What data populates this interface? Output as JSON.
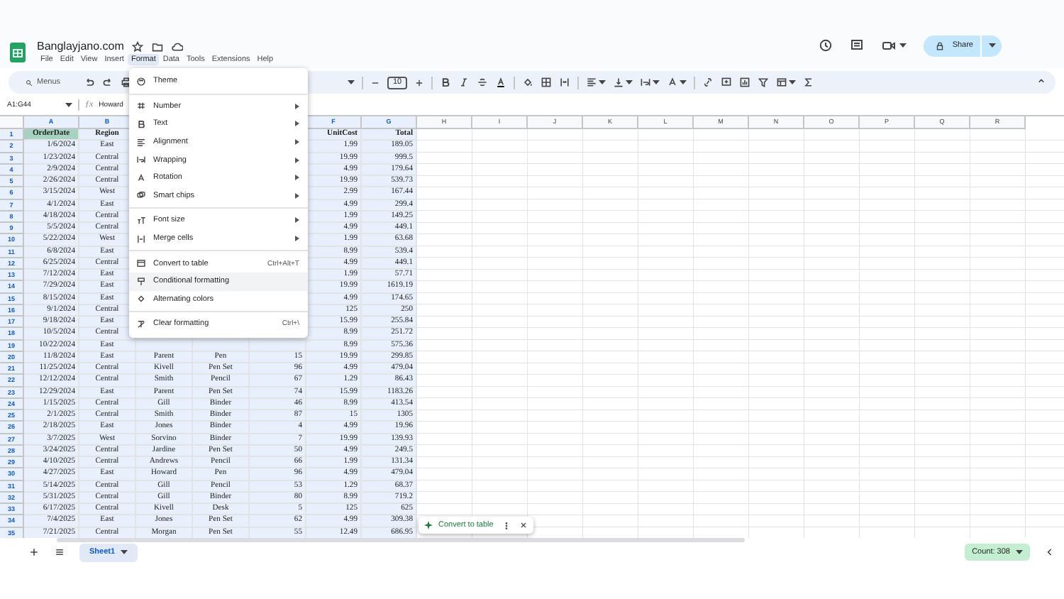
{
  "document": {
    "title": "Banglayjano.com",
    "menus": [
      {
        "label": "File",
        "selected": false
      },
      {
        "label": "Edit",
        "selected": false
      },
      {
        "label": "View",
        "selected": false
      },
      {
        "label": "Insert",
        "selected": false
      },
      {
        "label": "Format",
        "selected": true
      },
      {
        "label": "Data",
        "selected": false
      },
      {
        "label": "Tools",
        "selected": false
      },
      {
        "label": "Extensions",
        "selected": false
      },
      {
        "label": "Help",
        "selected": false
      }
    ],
    "share_button": "Share"
  },
  "toolbar": {
    "search": {
      "placeholder": "Menus"
    },
    "font_size": "10"
  },
  "formula_bar": {
    "name_box": "A1:G44",
    "function_symbol": "ƒx",
    "formula": "Howard"
  },
  "grid": {
    "columns": [
      {
        "label": "A",
        "selected": true
      },
      {
        "label": "B",
        "selected": true
      },
      null,
      null,
      null,
      {
        "label": "F",
        "selected": true
      },
      {
        "label": "G",
        "selected": true
      },
      {
        "label": "H",
        "selected": false
      },
      {
        "label": "I",
        "selected": false
      },
      {
        "label": "J",
        "selected": false
      },
      {
        "label": "K",
        "selected": false
      },
      {
        "label": "L",
        "selected": false
      },
      {
        "label": "M",
        "selected": false
      },
      {
        "label": "N",
        "selected": false
      },
      {
        "label": "O",
        "selected": false
      },
      {
        "label": "P",
        "selected": false
      },
      {
        "label": "Q",
        "selected": false
      },
      {
        "label": "R",
        "selected": false
      }
    ],
    "rows": [
      {
        "number": "1",
        "selected": true,
        "header": true,
        "cells": {
          "A": {
            "text": "OrderDate",
            "active": true
          },
          "B": "Region",
          "F": "UnitCost",
          "G": "Total"
        }
      },
      {
        "number": "2",
        "selected": true,
        "header": false,
        "cells": {
          "A": "1/6/2024",
          "B": "East",
          "F": "1.99",
          "G": "189.05"
        }
      },
      {
        "number": "3",
        "selected": true,
        "header": false,
        "cells": {
          "A": "1/23/2024",
          "B": "Central",
          "F": "19.99",
          "G": "999.5"
        }
      },
      {
        "number": "4",
        "selected": true,
        "header": false,
        "cells": {
          "A": "2/9/2024",
          "B": "Central",
          "F": "4.99",
          "G": "179.64"
        }
      },
      {
        "number": "5",
        "selected": true,
        "header": false,
        "cells": {
          "A": "2/26/2024",
          "B": "Central",
          "F": "19.99",
          "G": "539.73"
        }
      },
      {
        "number": "6",
        "selected": true,
        "header": false,
        "cells": {
          "A": "3/15/2024",
          "B": "West",
          "F": "2.99",
          "G": "167.44"
        }
      },
      {
        "number": "7",
        "selected": true,
        "header": false,
        "cells": {
          "A": "4/1/2024",
          "B": "East",
          "F": "4.99",
          "G": "299.4"
        }
      },
      {
        "number": "8",
        "selected": true,
        "header": false,
        "cells": {
          "A": "4/18/2024",
          "B": "Central",
          "F": "1.99",
          "G": "149.25"
        }
      },
      {
        "number": "9",
        "selected": true,
        "header": false,
        "cells": {
          "A": "5/5/2024",
          "B": "Central",
          "F": "4.99",
          "G": "449.1"
        }
      },
      {
        "number": "10",
        "selected": true,
        "header": false,
        "cells": {
          "A": "5/22/2024",
          "B": "West",
          "F": "1.99",
          "G": "63.68"
        }
      },
      {
        "number": "11",
        "selected": true,
        "header": false,
        "cells": {
          "A": "6/8/2024",
          "B": "East",
          "F": "8.99",
          "G": "539.4"
        }
      },
      {
        "number": "12",
        "selected": true,
        "header": false,
        "cells": {
          "A": "6/25/2024",
          "B": "Central",
          "F": "4.99",
          "G": "449.1"
        }
      },
      {
        "number": "13",
        "selected": true,
        "header": false,
        "cells": {
          "A": "7/12/2024",
          "B": "East",
          "F": "1.99",
          "G": "57.71"
        }
      },
      {
        "number": "14",
        "selected": true,
        "header": false,
        "cells": {
          "A": "7/29/2024",
          "B": "East",
          "F": "19.99",
          "G": "1619.19"
        }
      },
      {
        "number": "15",
        "selected": true,
        "header": false,
        "cells": {
          "A": "8/15/2024",
          "B": "East",
          "F": "4.99",
          "G": "174.65"
        }
      },
      {
        "number": "16",
        "selected": true,
        "header": false,
        "cells": {
          "A": "9/1/2024",
          "B": "Central",
          "F": "125",
          "G": "250"
        }
      },
      {
        "number": "17",
        "selected": true,
        "header": false,
        "cells": {
          "A": "9/18/2024",
          "B": "East",
          "F": "15.99",
          "G": "255.84"
        }
      },
      {
        "number": "18",
        "selected": true,
        "header": false,
        "cells": {
          "A": "10/5/2024",
          "B": "Central",
          "F": "8.99",
          "G": "251.72"
        }
      },
      {
        "number": "19",
        "selected": true,
        "header": false,
        "cells": {
          "A": "10/22/2024",
          "B": "East",
          "F": "8.99",
          "G": "575.36"
        }
      },
      {
        "number": "20",
        "selected": true,
        "header": false,
        "cells": {
          "A": "11/8/2024",
          "B": "East",
          "C": "Parent",
          "D": "Pen",
          "E": "15",
          "F": "19.99",
          "G": "299.85"
        }
      },
      {
        "number": "21",
        "selected": true,
        "header": false,
        "cells": {
          "A": "11/25/2024",
          "B": "Central",
          "C": "Kivell",
          "D": "Pen Set",
          "E": "96",
          "F": "4.99",
          "G": "479.04"
        }
      },
      {
        "number": "22",
        "selected": true,
        "header": false,
        "cells": {
          "A": "12/12/2024",
          "B": "Central",
          "C": "Smith",
          "D": "Pencil",
          "E": "67",
          "F": "1.29",
          "G": "86.43"
        }
      },
      {
        "number": "23",
        "selected": true,
        "header": false,
        "cells": {
          "A": "12/29/2024",
          "B": "East",
          "C": "Parent",
          "D": "Pen Set",
          "E": "74",
          "F": "15.99",
          "G": "1183.26"
        }
      },
      {
        "number": "24",
        "selected": true,
        "header": false,
        "cells": {
          "A": "1/15/2025",
          "B": "Central",
          "C": "Gill",
          "D": "Binder",
          "E": "46",
          "F": "8.99",
          "G": "413.54"
        }
      },
      {
        "number": "25",
        "selected": true,
        "header": false,
        "cells": {
          "A": "2/1/2025",
          "B": "Central",
          "C": "Smith",
          "D": "Binder",
          "E": "87",
          "F": "15",
          "G": "1305"
        }
      },
      {
        "number": "26",
        "selected": true,
        "header": false,
        "cells": {
          "A": "2/18/2025",
          "B": "East",
          "C": "Jones",
          "D": "Binder",
          "E": "4",
          "F": "4.99",
          "G": "19.96"
        }
      },
      {
        "number": "27",
        "selected": true,
        "header": false,
        "cells": {
          "A": "3/7/2025",
          "B": "West",
          "C": "Sorvino",
          "D": "Binder",
          "E": "7",
          "F": "19.99",
          "G": "139.93"
        }
      },
      {
        "number": "28",
        "selected": true,
        "header": false,
        "cells": {
          "A": "3/24/2025",
          "B": "Central",
          "C": "Jardine",
          "D": "Pen Set",
          "E": "50",
          "F": "4.99",
          "G": "249.5"
        }
      },
      {
        "number": "29",
        "selected": true,
        "header": false,
        "cells": {
          "A": "4/10/2025",
          "B": "Central",
          "C": "Andrews",
          "D": "Pencil",
          "E": "66",
          "F": "1.99",
          "G": "131.34"
        }
      },
      {
        "number": "30",
        "selected": true,
        "header": false,
        "cells": {
          "A": "4/27/2025",
          "B": "East",
          "C": "Howard",
          "D": "Pen",
          "E": "96",
          "F": "4.99",
          "G": "479.04"
        }
      },
      {
        "number": "31",
        "selected": true,
        "header": false,
        "cells": {
          "A": "5/14/2025",
          "B": "Central",
          "C": "Gill",
          "D": "Pencil",
          "E": "53",
          "F": "1.29",
          "G": "68.37"
        }
      },
      {
        "number": "32",
        "selected": true,
        "header": false,
        "cells": {
          "A": "5/31/2025",
          "B": "Central",
          "C": "Gill",
          "D": "Binder",
          "E": "80",
          "F": "8.99",
          "G": "719.2"
        }
      },
      {
        "number": "33",
        "selected": true,
        "header": false,
        "cells": {
          "A": "6/17/2025",
          "B": "Central",
          "C": "Kivell",
          "D": "Desk",
          "E": "5",
          "F": "125",
          "G": "625"
        }
      },
      {
        "number": "34",
        "selected": true,
        "header": false,
        "cells": {
          "A": "7/4/2025",
          "B": "East",
          "C": "Jones",
          "D": "Pen Set",
          "E": "62",
          "F": "4.99",
          "G": "309.38"
        }
      },
      {
        "number": "35",
        "selected": true,
        "header": false,
        "cells": {
          "A": "7/21/2025",
          "B": "Central",
          "C": "Morgan",
          "D": "Pen Set",
          "E": "55",
          "F": "12.49",
          "G": "686.95"
        }
      }
    ]
  },
  "format_menu": {
    "items": [
      {
        "kind": "item",
        "label": "Theme",
        "highlighted": false
      },
      {
        "kind": "divider"
      },
      {
        "kind": "submenu",
        "label": "Number",
        "highlighted": false
      },
      {
        "kind": "submenu",
        "label": "Text",
        "highlighted": false
      },
      {
        "kind": "submenu",
        "label": "Alignment",
        "highlighted": false
      },
      {
        "kind": "submenu",
        "label": "Wrapping",
        "highlighted": false
      },
      {
        "kind": "submenu",
        "label": "Rotation",
        "highlighted": false
      },
      {
        "kind": "submenu",
        "label": "Smart chips",
        "highlighted": false
      },
      {
        "kind": "divider"
      },
      {
        "kind": "submenu",
        "label": "Font size",
        "highlighted": false
      },
      {
        "kind": "submenu",
        "label": "Merge cells",
        "highlighted": false
      },
      {
        "kind": "divider"
      },
      {
        "kind": "item",
        "label": "Convert to table",
        "shortcut": "Ctrl+Alt+T",
        "highlighted": false
      },
      {
        "kind": "item",
        "label": "Conditional formatting",
        "highlighted": true
      },
      {
        "kind": "item",
        "label": "Alternating colors",
        "highlighted": false
      },
      {
        "kind": "divider"
      },
      {
        "kind": "item",
        "label": "Clear formatting",
        "shortcut": "Ctrl+\\",
        "highlighted": false
      }
    ]
  },
  "table_chip": {
    "label": "Convert to table"
  },
  "sheet_tabs": [
    {
      "label": "Sheet1",
      "selected": true
    }
  ],
  "status": {
    "count": "Count: 308"
  }
}
